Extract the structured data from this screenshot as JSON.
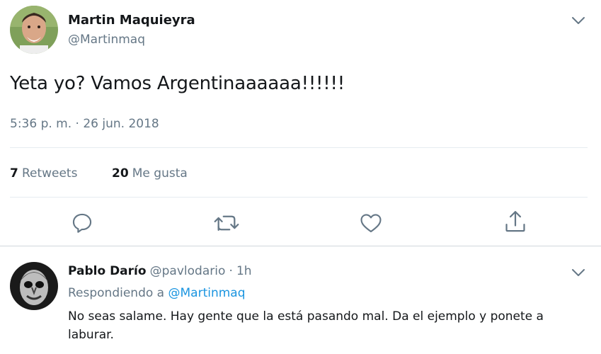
{
  "tweet": {
    "author_name": "Martin Maquieyra",
    "author_handle": "@Martinmaq",
    "text": "Yeta yo? Vamos Argentinaaaaaa!!!!!!",
    "time": "5:36 p. m. · 26 jun. 2018",
    "retweets_count": "7",
    "retweets_label": "Retweets",
    "likes_count": "20",
    "likes_label": "Me gusta"
  },
  "reply": {
    "author_name": "Pablo Darío",
    "author_handle": "@pavlodario",
    "separator": "·",
    "age": "1h",
    "replying_prefix": "Respondiendo a",
    "replying_handle": "@Martinmaq",
    "text_line1": "No seas salame. Hay gente que la está pasando mal. Da el ejemplo y ponete a",
    "text_line2": "laburar."
  },
  "colors": {
    "text": "#14171a",
    "secondary": "#657786",
    "link": "#1b95e0",
    "divider": "#e6ecf0"
  },
  "icons": [
    "chevron-down-icon",
    "reply-icon",
    "retweet-icon",
    "like-icon",
    "share-icon"
  ]
}
